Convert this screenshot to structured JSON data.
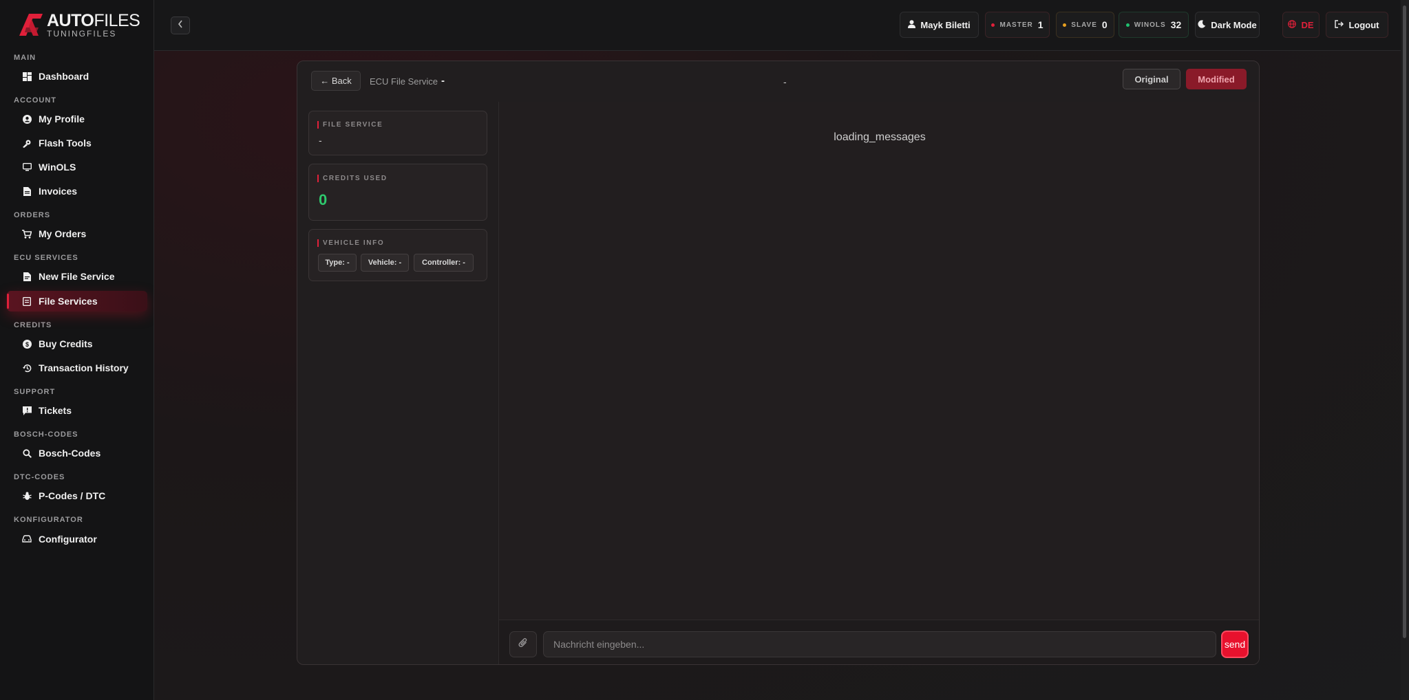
{
  "brand": {
    "name_bold": "AUTO",
    "name_thin": "FILES",
    "tagline": "TUNINGFILES",
    "accent": "#e0203a"
  },
  "sidebar": {
    "sections": [
      {
        "title": "MAIN",
        "items": [
          {
            "label": "Dashboard",
            "icon": "dashboard-icon"
          }
        ]
      },
      {
        "title": "ACCOUNT",
        "items": [
          {
            "label": "My Profile",
            "icon": "user-circle-icon"
          },
          {
            "label": "Flash Tools",
            "icon": "tools-icon"
          },
          {
            "label": "WinOLS",
            "icon": "monitor-icon"
          },
          {
            "label": "Invoices",
            "icon": "document-icon"
          }
        ]
      },
      {
        "title": "ORDERS",
        "items": [
          {
            "label": "My Orders",
            "icon": "cart-icon"
          }
        ]
      },
      {
        "title": "ECU SERVICES",
        "items": [
          {
            "label": "New File Service",
            "icon": "file-icon"
          },
          {
            "label": "File Services",
            "icon": "file-list-icon",
            "active": true
          }
        ]
      },
      {
        "title": "CREDITS",
        "items": [
          {
            "label": "Buy Credits",
            "icon": "dollar-icon"
          },
          {
            "label": "Transaction History",
            "icon": "history-icon"
          }
        ]
      },
      {
        "title": "SUPPORT",
        "items": [
          {
            "label": "Tickets",
            "icon": "ticket-icon"
          }
        ]
      },
      {
        "title": "BOSCH-CODES",
        "items": [
          {
            "label": "Bosch-Codes",
            "icon": "search-icon"
          }
        ]
      },
      {
        "title": "DTC-CODES",
        "items": [
          {
            "label": "P-Codes / DTC",
            "icon": "bug-icon"
          }
        ]
      },
      {
        "title": "KONFIGURATOR",
        "items": [
          {
            "label": "Configurator",
            "icon": "car-icon"
          }
        ]
      }
    ]
  },
  "topbar": {
    "user": "Mayk Biletti",
    "master": {
      "label": "MASTER",
      "value": "1",
      "color": "#e0203a"
    },
    "slave": {
      "label": "SLAVE",
      "value": "0",
      "color": "#e8a020"
    },
    "winols": {
      "label": "WINOLS",
      "value": "32",
      "color": "#20c070"
    },
    "theme": "Dark Mode",
    "lang": "DE",
    "logout": "Logout"
  },
  "panel": {
    "back": "← Back",
    "crumb": "ECU File Service",
    "crumb_value": "-",
    "center_value": "-",
    "toggle_original": "Original",
    "toggle_modified": "Modified",
    "file_service": {
      "title": "FILE SERVICE",
      "value": "-"
    },
    "credits_used": {
      "title": "CREDITS USED",
      "value": "0"
    },
    "vehicle_info": {
      "title": "VEHICLE INFO",
      "chips": [
        "Type: -",
        "Vehicle: -",
        "Controller: -"
      ]
    },
    "loading": "loading_messages",
    "input_placeholder": "Nachricht eingeben...",
    "send": "send"
  }
}
